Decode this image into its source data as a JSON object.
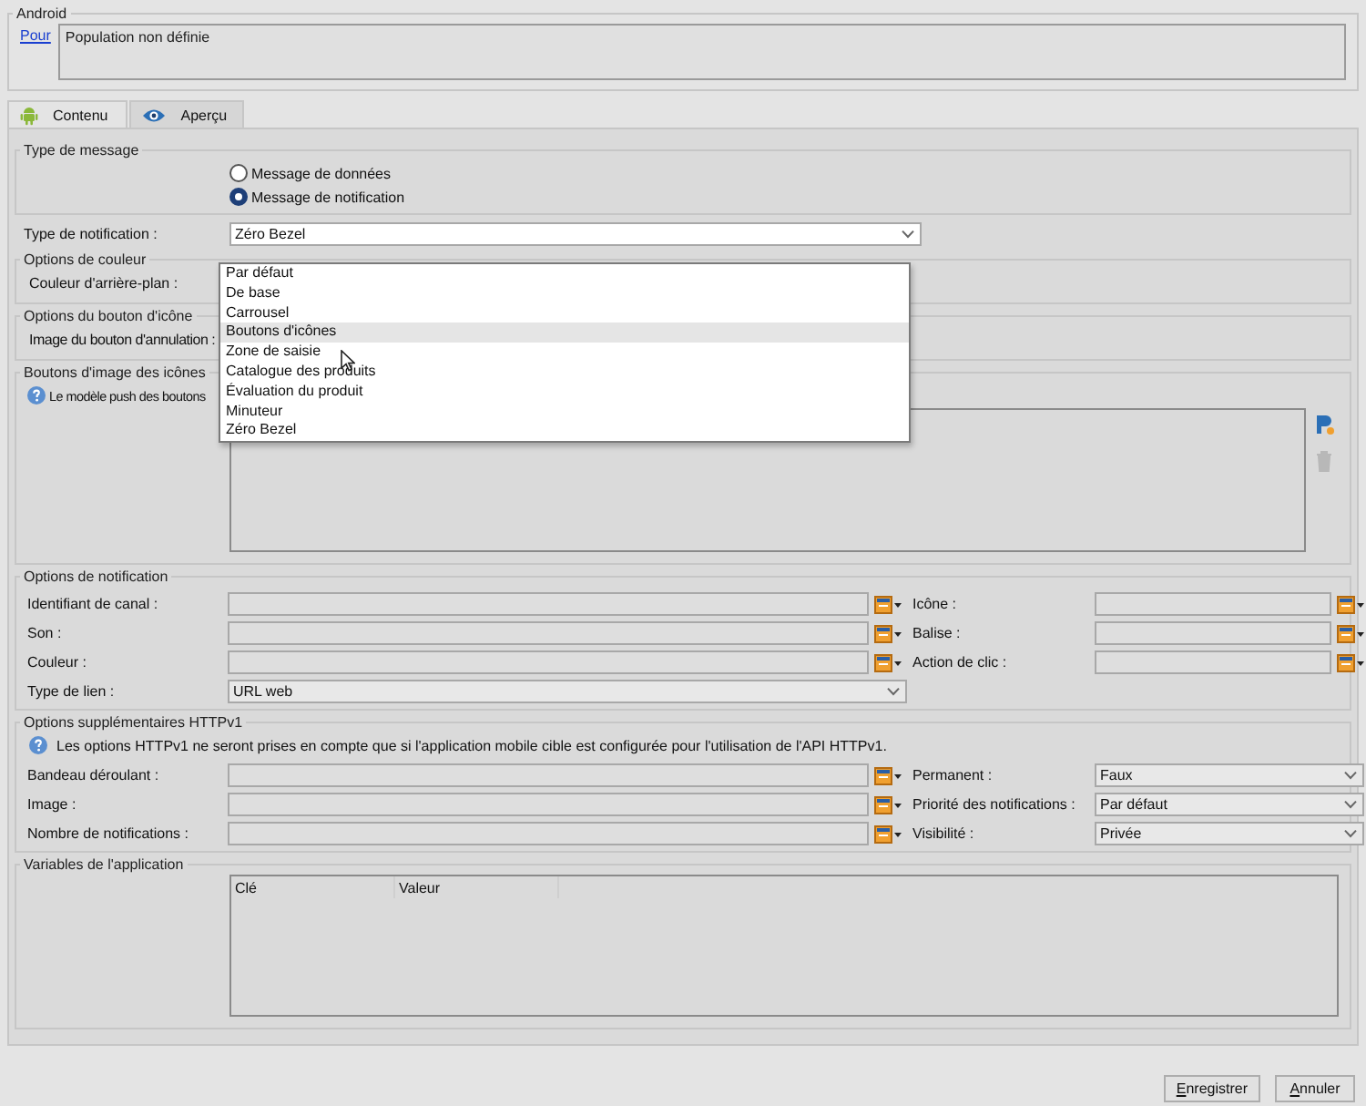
{
  "android_panel": {
    "title": "Android",
    "link": "Pour",
    "audience": "Population non définie"
  },
  "tabs": [
    {
      "label": "Contenu",
      "selected": true
    },
    {
      "label": "Aperçu",
      "selected": false
    }
  ],
  "message_type": {
    "title": "Type de message",
    "options": [
      {
        "label": "Message de données",
        "selected": false
      },
      {
        "label": "Message de notification",
        "selected": true
      }
    ]
  },
  "notification_type": {
    "label": "Type de notification :",
    "value": "Zéro Bezel",
    "dropdown": [
      {
        "label": "Par défaut",
        "highlighted": false
      },
      {
        "label": "De base",
        "highlighted": false
      },
      {
        "label": "Carrousel",
        "highlighted": false
      },
      {
        "label": "Boutons d'icônes",
        "highlighted": true
      },
      {
        "label": "Zone de saisie",
        "highlighted": false
      },
      {
        "label": "Catalogue des produits",
        "highlighted": false
      },
      {
        "label": "Évaluation du produit",
        "highlighted": false
      },
      {
        "label": "Minuteur",
        "highlighted": false
      },
      {
        "label": "Zéro Bezel",
        "highlighted": false
      }
    ]
  },
  "color_options": {
    "title": "Options de couleur",
    "label": "Couleur d'arrière-plan :"
  },
  "icon_button_options": {
    "title": "Options du bouton d'icône",
    "label": "Image du bouton d'annulation :"
  },
  "icon_image_buttons": {
    "title": "Boutons d'image des icônes",
    "info": "Le modèle push des boutons"
  },
  "notification_options": {
    "title": "Options de notification",
    "rows": [
      {
        "left": "Identifiant de canal :",
        "right": {
          "label": "Icône :",
          "kind": "text"
        }
      },
      {
        "left": "Son :",
        "right": {
          "label": "Balise :",
          "kind": "text"
        }
      },
      {
        "left": "Couleur :",
        "right": {
          "label": "Action de clic :",
          "kind": "text"
        }
      }
    ],
    "link_type": {
      "label": "Type de lien :",
      "value": "URL web"
    }
  },
  "httpv1": {
    "title": "Options supplémentaires HTTPv1",
    "info": "Les options HTTPv1 ne seront prises en compte que si l'application mobile cible est configurée pour l'utilisation de l'API HTTPv1.",
    "rows": [
      {
        "left": "Bandeau déroulant :",
        "right": {
          "label": "Permanent :",
          "kind": "combo",
          "value": "Faux"
        }
      },
      {
        "left": "Image :",
        "right": {
          "label": "Priorité des notifications :",
          "kind": "combo",
          "value": "Par défaut"
        }
      },
      {
        "left": "Nombre de notifications :",
        "right": {
          "label": "Visibilité :",
          "kind": "combo",
          "value": "Privée"
        }
      }
    ]
  },
  "app_variables": {
    "title": "Variables de l'application",
    "columns": [
      "Clé",
      "Valeur"
    ]
  },
  "buttons": [
    "Enregistrer",
    "Annuler"
  ]
}
